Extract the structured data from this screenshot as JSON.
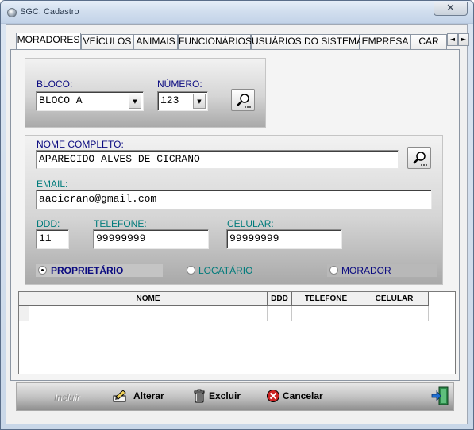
{
  "window": {
    "title": "SGC: Cadastro",
    "close_glyph": "✕"
  },
  "tabs": [
    {
      "label": "MORADORES",
      "active": true
    },
    {
      "label": "VEÍCULOS"
    },
    {
      "label": "ANIMAIS"
    },
    {
      "label": "FUNCIONÁRIOS"
    },
    {
      "label": "USUÁRIOS DO SISTEMA"
    },
    {
      "label": "EMPRESA"
    },
    {
      "label": "CAR"
    }
  ],
  "tab_scroll": {
    "left": "◄",
    "right": "►"
  },
  "unit": {
    "bloco_label": "BLOCO:",
    "bloco_value": "BLOCO A",
    "numero_label": "NÚMERO:",
    "numero_value": "123"
  },
  "person": {
    "nome_label": "NOME COMPLETO:",
    "nome_value": "APARECIDO ALVES DE CICRANO",
    "email_label": "EMAIL:",
    "email_value": "aacicrano@gmail.com",
    "ddd_label": "DDD:",
    "ddd_value": "11",
    "telefone_label": "TELEFONE:",
    "telefone_value": "99999999",
    "celular_label": "CELULAR:",
    "celular_value": "99999999"
  },
  "tipo": {
    "options": [
      {
        "label": "PROPRIETÁRIO",
        "checked": true
      },
      {
        "label": "LOCATÁRIO",
        "checked": false
      },
      {
        "label": "MORADOR",
        "checked": false
      }
    ]
  },
  "grid": {
    "columns": [
      "NOME",
      "DDD",
      "TELEFONE",
      "CELULAR"
    ],
    "rows": [
      [
        "",
        "",
        "",
        ""
      ]
    ]
  },
  "toolbar": {
    "incluir": "Incluir",
    "alterar": "Alterar",
    "excluir": "Excluir",
    "cancelar": "Cancelar"
  },
  "colors": {
    "label_blue": "#0b0b80",
    "label_teal": "#007b7b",
    "cancel_red": "#cc2222"
  }
}
